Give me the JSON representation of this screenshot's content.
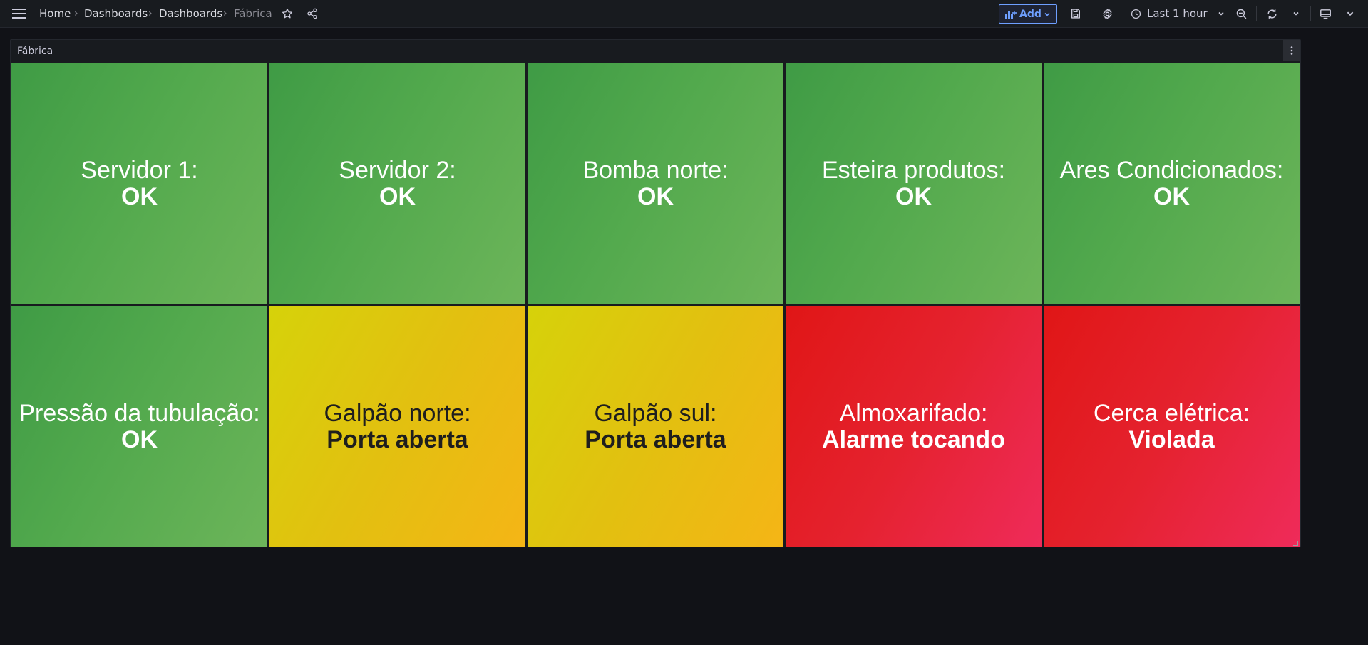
{
  "nav": {
    "breadcrumbs": [
      "Home",
      "Dashboards",
      "Dashboards",
      "Fábrica"
    ],
    "add_label": "Add",
    "time_range": "Last 1 hour"
  },
  "panel": {
    "title": "Fábrica",
    "tiles": [
      {
        "label": "Servidor 1:",
        "value": "OK",
        "status": "green"
      },
      {
        "label": "Servidor 2:",
        "value": "OK",
        "status": "green"
      },
      {
        "label": "Bomba norte:",
        "value": "OK",
        "status": "green"
      },
      {
        "label": "Esteira produtos:",
        "value": "OK",
        "status": "green"
      },
      {
        "label": "Ares Condicionados:",
        "value": "OK",
        "status": "green"
      },
      {
        "label": "Pressão da tubulação:",
        "value": "OK",
        "status": "green"
      },
      {
        "label": "Galpão norte:",
        "value": "Porta aberta",
        "status": "yellow"
      },
      {
        "label": "Galpão sul:",
        "value": "Porta aberta",
        "status": "yellow"
      },
      {
        "label": "Almoxarifado:",
        "value": "Alarme tocando",
        "status": "red"
      },
      {
        "label": "Cerca elétrica:",
        "value": "Violada",
        "status": "red"
      }
    ]
  },
  "colors": {
    "ok": "#52a94d",
    "warning": "#e2c010",
    "critical": "#e5222f",
    "accent": "#6e9fff"
  }
}
